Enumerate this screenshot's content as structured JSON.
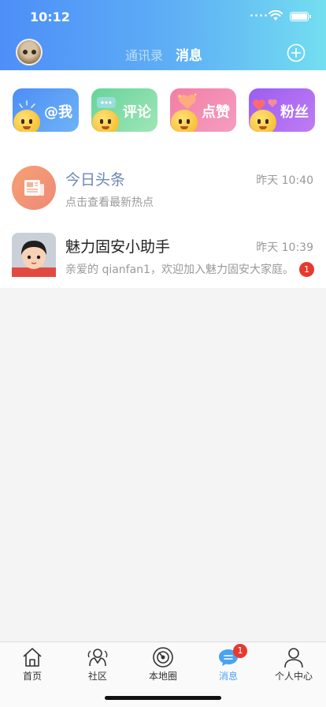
{
  "status_bar": {
    "time": "10:12"
  },
  "header": {
    "tabs": [
      {
        "label": "通讯录",
        "active": false
      },
      {
        "label": "消息",
        "active": true
      }
    ]
  },
  "categories": [
    {
      "label": "@我",
      "icon": "at-me-icon",
      "gradient": [
        "#4c8ef7",
        "#6fb3f5"
      ]
    },
    {
      "label": "评论",
      "icon": "comment-icon",
      "gradient": [
        "#67d39a",
        "#9fe6b6"
      ]
    },
    {
      "label": "点赞",
      "icon": "like-icon",
      "gradient": [
        "#f37ea6",
        "#f49dc0"
      ]
    },
    {
      "label": "粉丝",
      "icon": "fans-icon",
      "gradient": [
        "#9b5df2",
        "#c07cf3"
      ]
    }
  ],
  "messages": [
    {
      "title": "今日头条",
      "time": "昨天 10:40",
      "subtitle": "点击查看最新热点",
      "icon": "newspaper-icon",
      "title_color": "#6d86b3"
    },
    {
      "title": "魅力固安小助手",
      "time": "昨天 10:39",
      "subtitle": "亲爱的 qianfan1，欢迎加入魅力固安大家庭。",
      "badge": "1",
      "icon": "assistant-avatar",
      "title_color": "#222222"
    }
  ],
  "tabbar": {
    "items": [
      {
        "label": "首页",
        "icon": "home-icon"
      },
      {
        "label": "社区",
        "icon": "community-icon"
      },
      {
        "label": "本地圈",
        "icon": "local-circle-icon"
      },
      {
        "label": "消息",
        "icon": "message-icon",
        "active": true,
        "badge": "1"
      },
      {
        "label": "个人中心",
        "icon": "profile-icon"
      }
    ]
  },
  "colors": {
    "accent": "#4aa3f0",
    "badge": "#e8392f"
  }
}
